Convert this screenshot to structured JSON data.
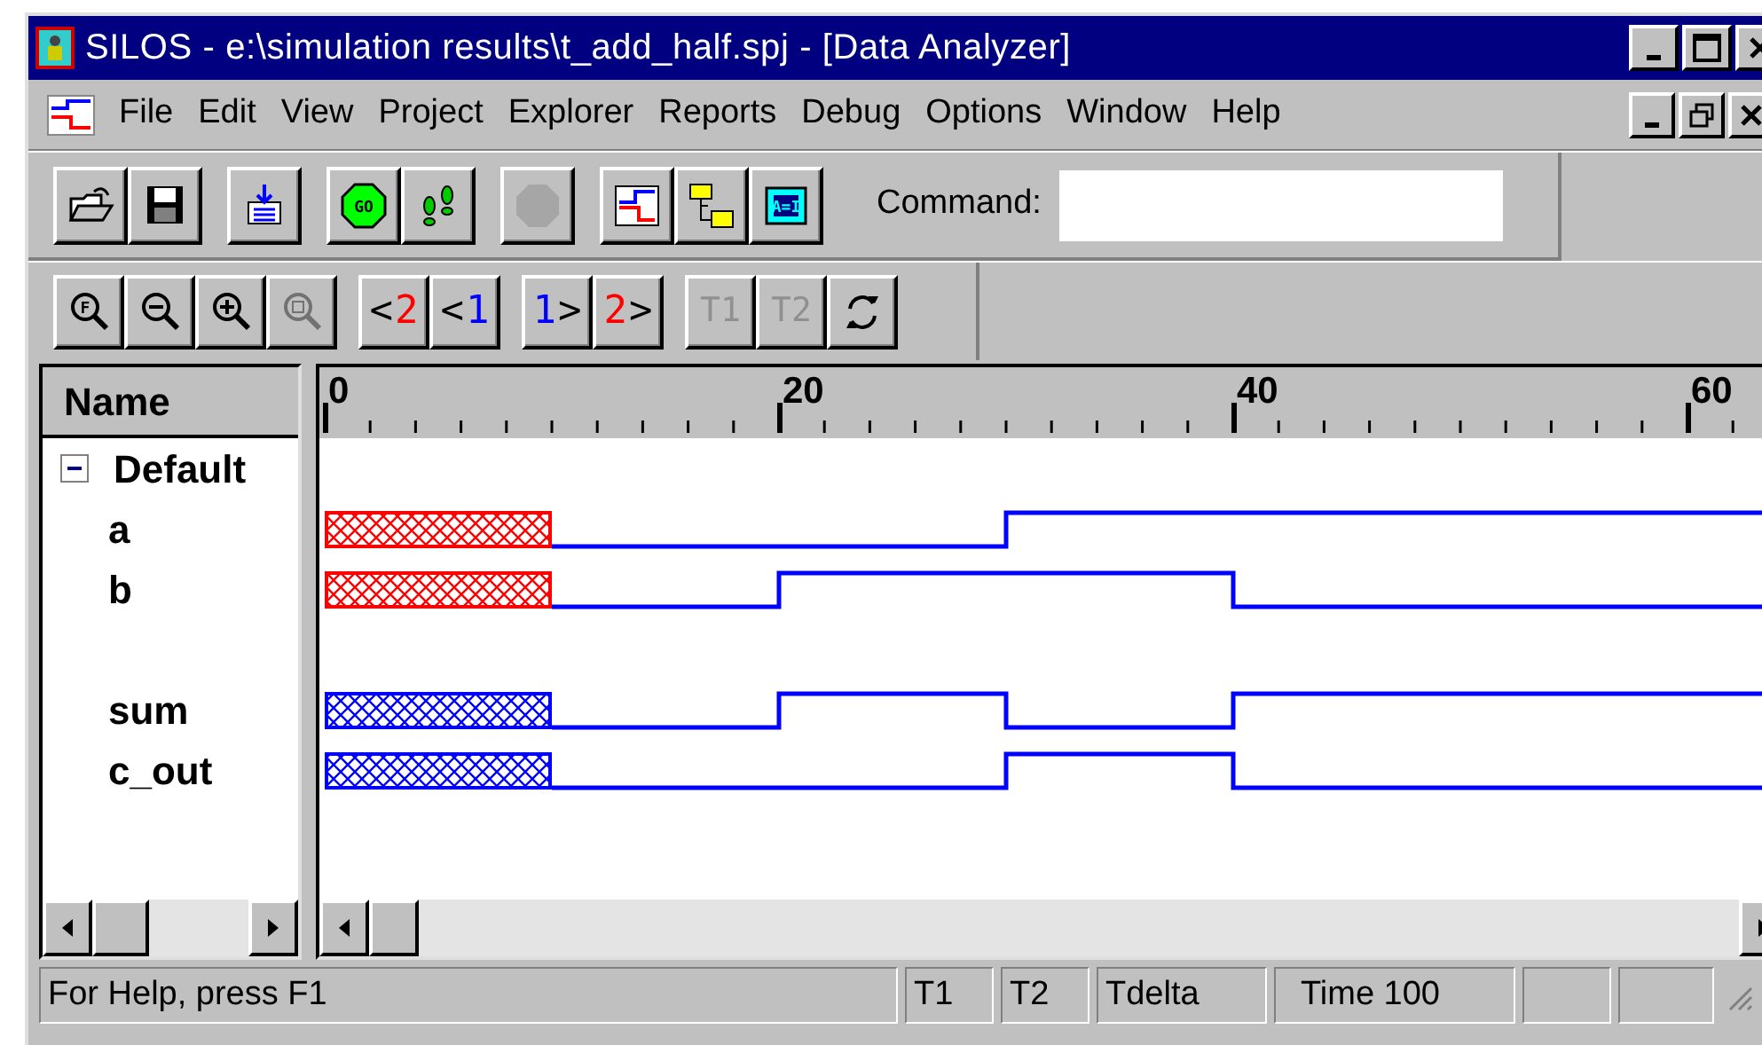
{
  "window": {
    "title": "SILOS - e:\\simulation results\\t_add_half.spj - [Data Analyzer]"
  },
  "menu": [
    "File",
    "Edit",
    "View",
    "Project",
    "Explorer",
    "Reports",
    "Debug",
    "Options",
    "Window",
    "Help"
  ],
  "toolbar": {
    "groups": [
      [
        {
          "disabled": false
        },
        {
          "disabled": false
        }
      ],
      [
        {
          "disabled": false
        }
      ],
      [
        {
          "label": "GO",
          "disabled": false
        },
        {
          "disabled": false
        }
      ],
      [
        {
          "disabled": true
        }
      ],
      [
        {
          "disabled": false
        },
        {
          "disabled": false
        },
        {
          "label": "A=I",
          "disabled": false
        }
      ]
    ],
    "command_label": "Command:"
  },
  "viewbar": {
    "groups": [
      [
        {
          "kind": "icon",
          "label": "F",
          "disabled": false
        },
        {
          "kind": "icon",
          "disabled": false
        },
        {
          "kind": "icon",
          "disabled": false
        },
        {
          "kind": "icon",
          "disabled": true
        }
      ],
      [
        {
          "kind": "cursor",
          "arrow": "<",
          "label": "2",
          "color": "#ff0000",
          "disabled": false
        },
        {
          "kind": "cursor",
          "arrow": "<",
          "label": "1",
          "color": "#0000ff",
          "disabled": false
        }
      ],
      [
        {
          "kind": "cursor-right",
          "arrow": ">",
          "label": "1",
          "color": "#0000ff",
          "disabled": false
        },
        {
          "kind": "cursor-right",
          "arrow": ">",
          "label": "2",
          "color": "#ff0000",
          "disabled": false
        }
      ],
      [
        {
          "kind": "text",
          "label": "T1",
          "disabled": true
        },
        {
          "kind": "text",
          "label": "T2",
          "disabled": true
        },
        {
          "kind": "icon",
          "disabled": false
        }
      ]
    ]
  },
  "name_pane": {
    "header": "Name",
    "tree": {
      "label": "Default",
      "expanded": true,
      "children": [
        {
          "kind": "signal",
          "label": "a",
          "color": "#ff0000",
          "segments": [
            {
              "kind": "unknown"
            },
            {
              "kind": "low"
            },
            {
              "kind": "low"
            },
            {
              "kind": "high"
            },
            {
              "kind": "high"
            },
            {
              "kind": "high"
            },
            {
              "kind": "high"
            }
          ]
        },
        {
          "kind": "signal",
          "label": "b",
          "color": "#ff0000",
          "segments": [
            {
              "kind": "unknown"
            },
            {
              "kind": "low"
            },
            {
              "kind": "high"
            },
            {
              "kind": "high"
            },
            {
              "kind": "low"
            },
            {
              "kind": "low"
            },
            {
              "kind": "low"
            }
          ]
        },
        {
          "kind": "spacer"
        },
        {
          "kind": "signal",
          "label": "sum",
          "color": "#0000ff",
          "segments": [
            {
              "kind": "unknown"
            },
            {
              "kind": "low"
            },
            {
              "kind": "high"
            },
            {
              "kind": "low"
            },
            {
              "kind": "high"
            },
            {
              "kind": "high"
            },
            {
              "kind": "high"
            }
          ]
        },
        {
          "kind": "signal",
          "label": "c_out",
          "color": "#0000ff",
          "segments": [
            {
              "kind": "unknown"
            },
            {
              "kind": "low"
            },
            {
              "kind": "low"
            },
            {
              "kind": "high"
            },
            {
              "kind": "low"
            },
            {
              "kind": "low"
            },
            {
              "kind": "low"
            }
          ]
        }
      ]
    }
  },
  "ruler": {
    "labels": [
      "0",
      "20",
      "40",
      "60"
    ]
  },
  "status_bar": [
    "For Help, press F1",
    "T1",
    "T2",
    "Tdelta",
    "Time 100"
  ]
}
